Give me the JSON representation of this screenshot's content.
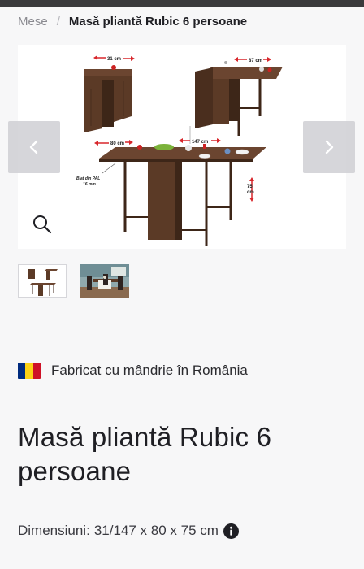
{
  "breadcrumb": {
    "parent": "Mese",
    "separator": "/",
    "current": "Masă pliantă Rubic 6 persoane"
  },
  "gallery": {
    "prev_icon": "chevron-left-icon",
    "next_icon": "chevron-right-icon",
    "zoom_icon": "magnifier-icon",
    "labels": {
      "depth_closed": "31 cm",
      "depth_mid": "87 cm",
      "width_open": "147 cm",
      "depth_open": "80 cm",
      "height": "75",
      "height_unit": "cm",
      "board_note_1": "Blat din PAL",
      "board_note_2": "16 mm"
    },
    "thumbnails": [
      "product-diagram-thumb",
      "room-photo-thumb"
    ]
  },
  "origin": {
    "flag": "romania-flag",
    "text": "Fabricat cu mândrie în România",
    "flag_colors": [
      "#002b7f",
      "#fcd116",
      "#ce1126"
    ]
  },
  "product": {
    "title": "Masă pliantă Rubic 6 persoane",
    "dimensions_label": "Dimensiuni:",
    "dimensions_value": "31/147 x 80 x 75 cm",
    "info_icon": "info-icon"
  },
  "colors": {
    "wood": "#5b3a26",
    "wood_dark": "#3d2618",
    "arrow_red": "#d8262b",
    "text_main": "#1f1f24",
    "text_muted": "#8a8a90"
  }
}
